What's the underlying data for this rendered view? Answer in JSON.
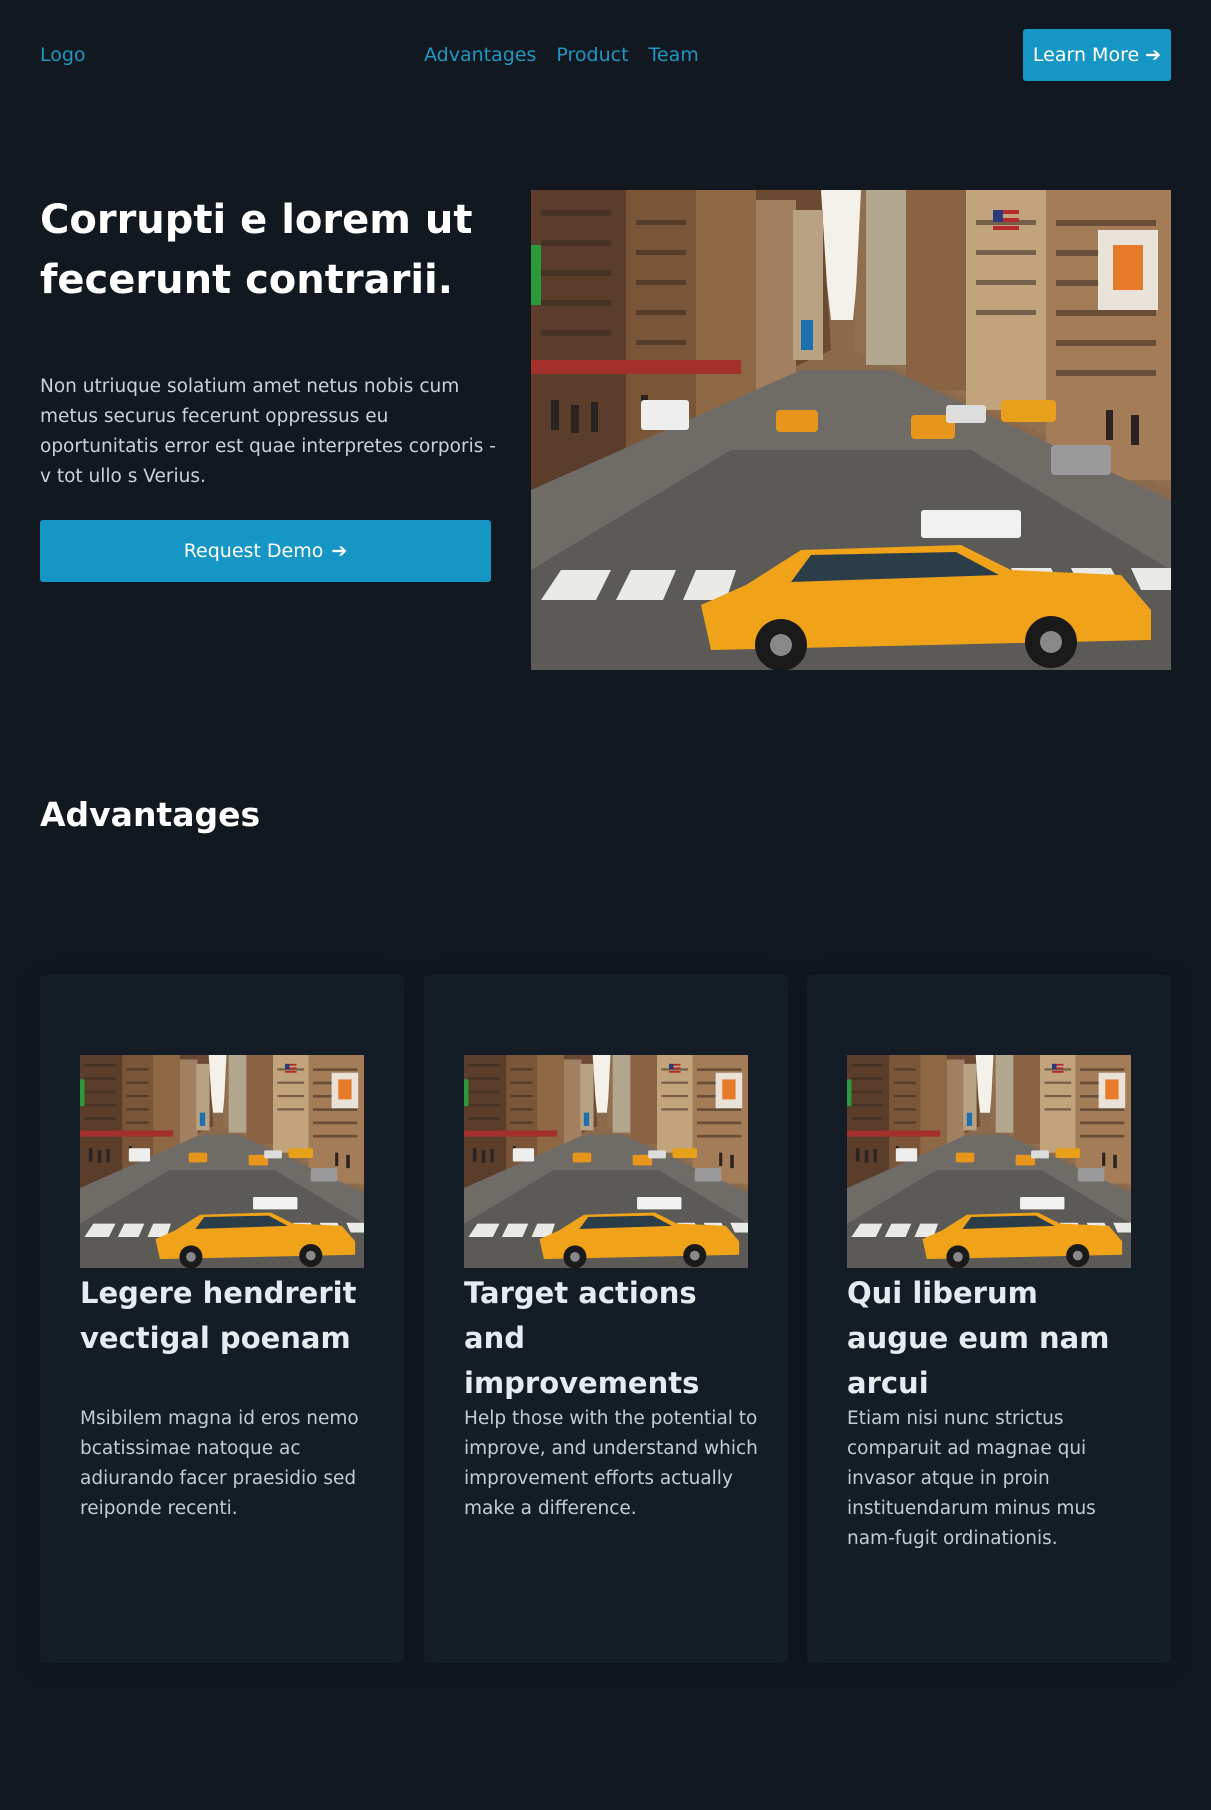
{
  "header": {
    "logo": "Logo",
    "nav": [
      "Advantages",
      "Product",
      "Team"
    ],
    "cta_label": "Learn More",
    "cta_arrow": "➔"
  },
  "hero": {
    "title": "Corrupti e lorem ut fecerunt contrarii.",
    "text": "Non utriuque solatium amet netus nobis cum metus securus fecerunt oppressus eu oportunitatis error est quae interpretes corporis - v tot ullo s Verius.",
    "cta_label": "Request Demo",
    "cta_arrow": "➔",
    "image": "city-street-taxi-photo"
  },
  "advantages": {
    "title": "Advantages",
    "cards": [
      {
        "title": "Legere hendrerit vectigal poenam",
        "text": "Msibilem magna id eros nemo bcatissimae natoque ac adiurando facer praesidio sed reiponde recenti.",
        "image": "city-street-taxi-photo"
      },
      {
        "title": "Target actions and improvements",
        "text": "Help those with the potential to improve, and understand which improvement efforts actually make a difference.",
        "image": "city-street-taxi-photo"
      },
      {
        "title": "Qui liberum augue eum nam arcui",
        "text": "Etiam nisi nunc strictus comparuit ad magnae qui invasor atque in proin instituendarum minus mus nam-fugit ordinationis.",
        "image": "city-street-taxi-photo"
      }
    ]
  },
  "colors": {
    "background": "#111820",
    "card": "#141c25",
    "accent": "#1596c4",
    "link": "#2196c4",
    "taxi": "#f0a218"
  }
}
